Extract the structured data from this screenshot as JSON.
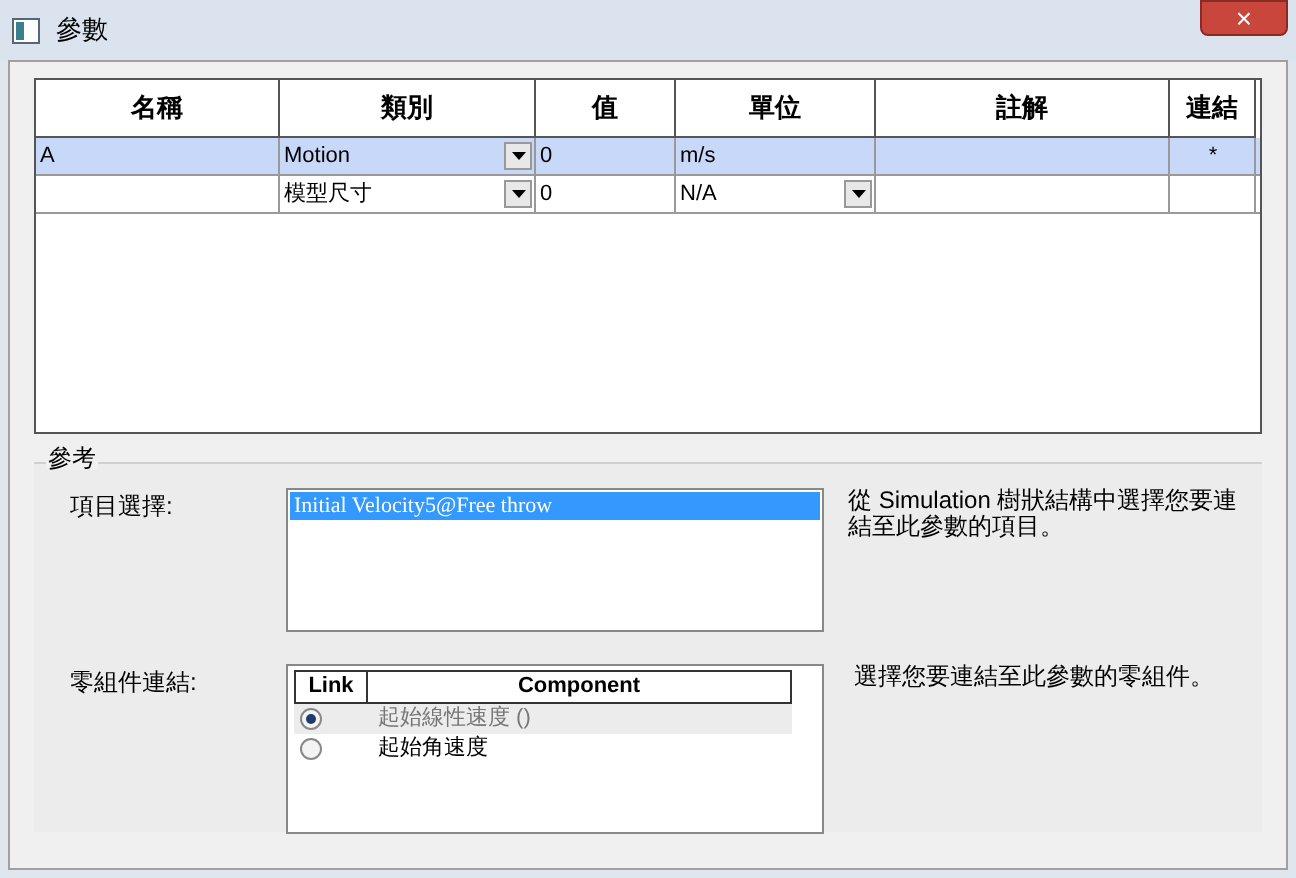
{
  "window": {
    "title": "參數",
    "close": "×"
  },
  "table": {
    "columns": [
      "名稱",
      "類別",
      "值",
      "單位",
      "註解",
      "連結"
    ],
    "rows": [
      {
        "selected": true,
        "name": "A",
        "category": "Motion",
        "value": "0",
        "unit": "m/s",
        "unit_dropdown": false,
        "comment": "",
        "link": "*"
      },
      {
        "selected": false,
        "name": "",
        "category": "模型尺寸",
        "value": "0",
        "unit": "N/A",
        "unit_dropdown": true,
        "comment": "",
        "link": ""
      }
    ]
  },
  "reference": {
    "title": "參考",
    "item_selection": {
      "label": "項目選擇:",
      "items": [
        {
          "text": "Initial Velocity5@Free throw",
          "selected": true
        }
      ],
      "hint": "從 Simulation 樹狀結構中選擇您要連結至此參數的項目。"
    },
    "component_link": {
      "label": "零組件連結:",
      "columns": [
        "Link",
        "Component"
      ],
      "rows": [
        {
          "checked": true,
          "selected": true,
          "component": "起始線性速度 ()"
        },
        {
          "checked": false,
          "selected": false,
          "component": "起始角速度"
        }
      ],
      "hint": "選擇您要連結至此參數的零組件。"
    }
  }
}
